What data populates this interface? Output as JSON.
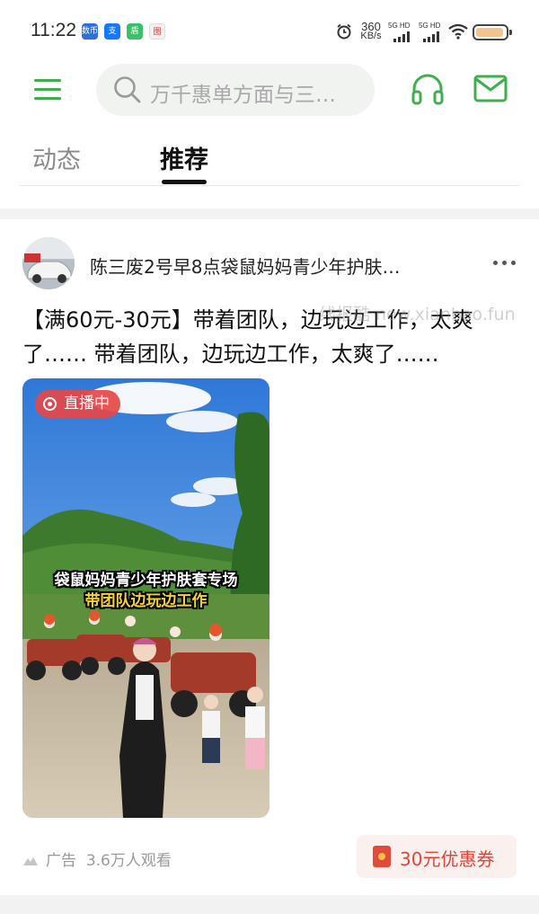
{
  "status_bar": {
    "time": "11:22",
    "app_badges": [
      "数币",
      "支",
      "盾",
      "图"
    ],
    "net_speed_value": "360",
    "net_speed_unit": "KB/s",
    "signal_labels": [
      "5G HD",
      "5G HD"
    ],
    "icons": [
      "alarm-icon",
      "signal-icon",
      "signal-icon",
      "wifi-icon",
      "battery-icon"
    ]
  },
  "header": {
    "search_placeholder": "万千惠单方面与三…",
    "accent_color": "#3fae4e",
    "icons": [
      "menu-icon",
      "search-icon",
      "headset-icon",
      "mail-icon"
    ]
  },
  "tabs": [
    {
      "label": "动态",
      "active": false
    },
    {
      "label": "推荐",
      "active": true
    }
  ],
  "post": {
    "author": "陈三废2号早8点袋鼠妈妈青少年护肤…",
    "title": "【满60元-30元】带着团队，边玩边工作，太爽了…… 带着团队，边玩边工作，太爽了……",
    "watermark": "线报酷 new.xianbao.fun",
    "video": {
      "live_badge": "直播中",
      "caption_line1": "袋鼠妈妈青少年护肤套专场",
      "caption_line2": "带团队边玩边工作"
    },
    "footer": {
      "ad_label": "广告",
      "views": "3.6万人观看",
      "coupon": "30元优惠券"
    }
  }
}
